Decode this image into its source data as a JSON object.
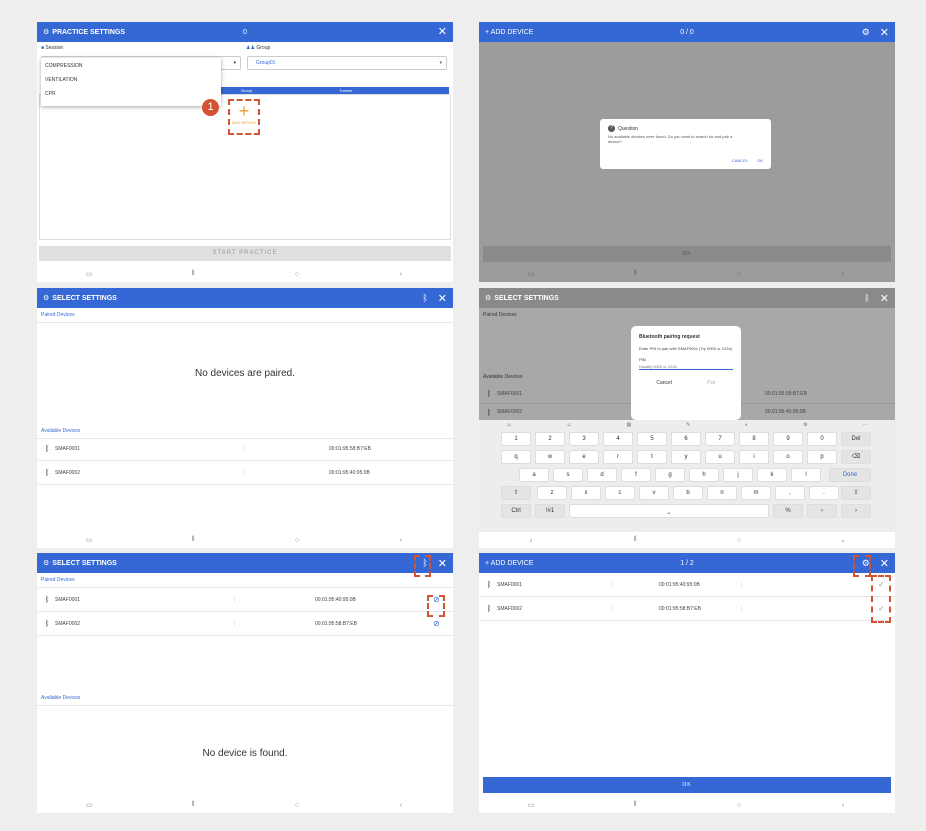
{
  "p1": {
    "title": "PRACTICE SETTINGS",
    "counter": "0",
    "session_label": "Session",
    "group_label": "Group",
    "group_value": "Group01",
    "session_options": [
      "COMPRESSION",
      "VENTILATION",
      "CPR"
    ],
    "col_group": "Group",
    "col_trainee": "Trainee",
    "step_number": "1",
    "add_device_label": "ADD DEVICE",
    "start_label": "START PRACTICE"
  },
  "p2": {
    "title": "+ ADD DEVICE",
    "counter": "0 / 0",
    "dialog_title": "Question",
    "dialog_body": "No available devices were found. Do you want to search for and pair a device?",
    "cancel": "CANCEL",
    "ok": "OK",
    "ok_bar": "OK"
  },
  "p3": {
    "title": "SELECT SETTINGS",
    "paired_label": "Paired Devices",
    "empty_paired": "No devices are paired.",
    "available_label": "Available Devices",
    "devices": [
      {
        "name": "SMAF0001",
        "mac": "00:01:95:58:B7:EB"
      },
      {
        "name": "SMAF0002",
        "mac": "00:01:95:40:95:0B"
      }
    ]
  },
  "p4": {
    "title": "SELECT SETTINGS",
    "paired_label": "Paired Devices",
    "available_label": "Available Devices",
    "dialog_title": "Bluetooth pairing request",
    "dialog_body": "Enter PIN to pair with SMAF0001 (Try 0000 or 1234)",
    "pin_label": "PIN",
    "pin_placeholder": "Usually 0000 or 1234",
    "cancel": "Cancel",
    "pair": "Pair",
    "devices": [
      {
        "name": "SMAF0001",
        "mac": "00:01:95:58:B7:EB"
      },
      {
        "name": "SMAF0002",
        "mac": "00:01:95:40:95:0B"
      }
    ],
    "keys_row1": [
      "1",
      "2",
      "3",
      "4",
      "5",
      "6",
      "7",
      "8",
      "9",
      "0"
    ],
    "keys_row2": [
      "q",
      "w",
      "e",
      "r",
      "t",
      "y",
      "u",
      "i",
      "o",
      "p"
    ],
    "keys_row3": [
      "a",
      "s",
      "d",
      "f",
      "g",
      "h",
      "j",
      "k",
      "l"
    ],
    "keys_row4": [
      "z",
      "x",
      "c",
      "v",
      "b",
      "n",
      "m",
      ",",
      "."
    ],
    "key_del": "Del",
    "key_done": "Done",
    "key_ctrl": "Ctrl",
    "key_sym": "!#1"
  },
  "p5": {
    "title": "SELECT SETTINGS",
    "paired_label": "Paired Devices",
    "available_label": "Available Devices",
    "empty_available": "No device is found.",
    "devices": [
      {
        "name": "SMAF0001",
        "mac": "00:01:95:40:95:0B"
      },
      {
        "name": "SMAF0002",
        "mac": "00:01:95:58:B7:EB"
      }
    ]
  },
  "p6": {
    "title": "+ ADD DEVICE",
    "counter": "1 / 2",
    "ok_bar": "OK",
    "devices": [
      {
        "name": "SMAF0001",
        "mac": "00:01:95:40:95:0B"
      },
      {
        "name": "SMAF0002",
        "mac": "00:01:95:58:B7:EB"
      }
    ]
  },
  "colors": {
    "accent": "#3568d4",
    "highlight": "#d35432"
  },
  "icons": [
    "gear-icon",
    "close-icon",
    "bluetooth-icon",
    "folder-icon",
    "group-icon",
    "plus-icon",
    "question-icon",
    "check-icon",
    "unpair-icon",
    "recent-apps-icon",
    "home-icon",
    "back-icon",
    "keyboard-icon"
  ]
}
